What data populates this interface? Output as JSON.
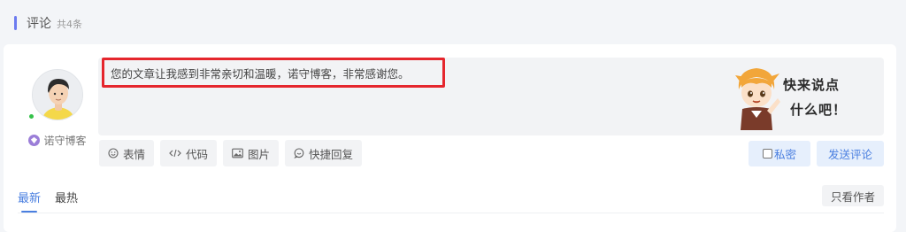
{
  "header": {
    "title": "评论",
    "count": "共4条"
  },
  "user": {
    "name": "诺守博客",
    "online": true
  },
  "editor": {
    "content": "您的文章让我感到非常亲切和温暖，诺守博客，非常感谢您。",
    "mascot_line1": "快来说点",
    "mascot_line2": "什么吧！"
  },
  "toolbar": {
    "items": [
      {
        "label": "表情",
        "icon": "smile-icon"
      },
      {
        "label": "代码",
        "icon": "code-icon"
      },
      {
        "label": "图片",
        "icon": "image-icon"
      },
      {
        "label": "快捷回复",
        "icon": "chat-icon"
      }
    ]
  },
  "actions": {
    "private_label": "私密",
    "send_label": "发送评论"
  },
  "tabs": [
    {
      "label": "最新",
      "active": true
    },
    {
      "label": "最热",
      "active": false
    }
  ],
  "filter": {
    "only_author_label": "只看作者"
  },
  "colors": {
    "accent": "#4a7fe0",
    "highlight_border": "#e5262d",
    "section_bar": "#6c7bf0",
    "online": "#35c24a"
  }
}
